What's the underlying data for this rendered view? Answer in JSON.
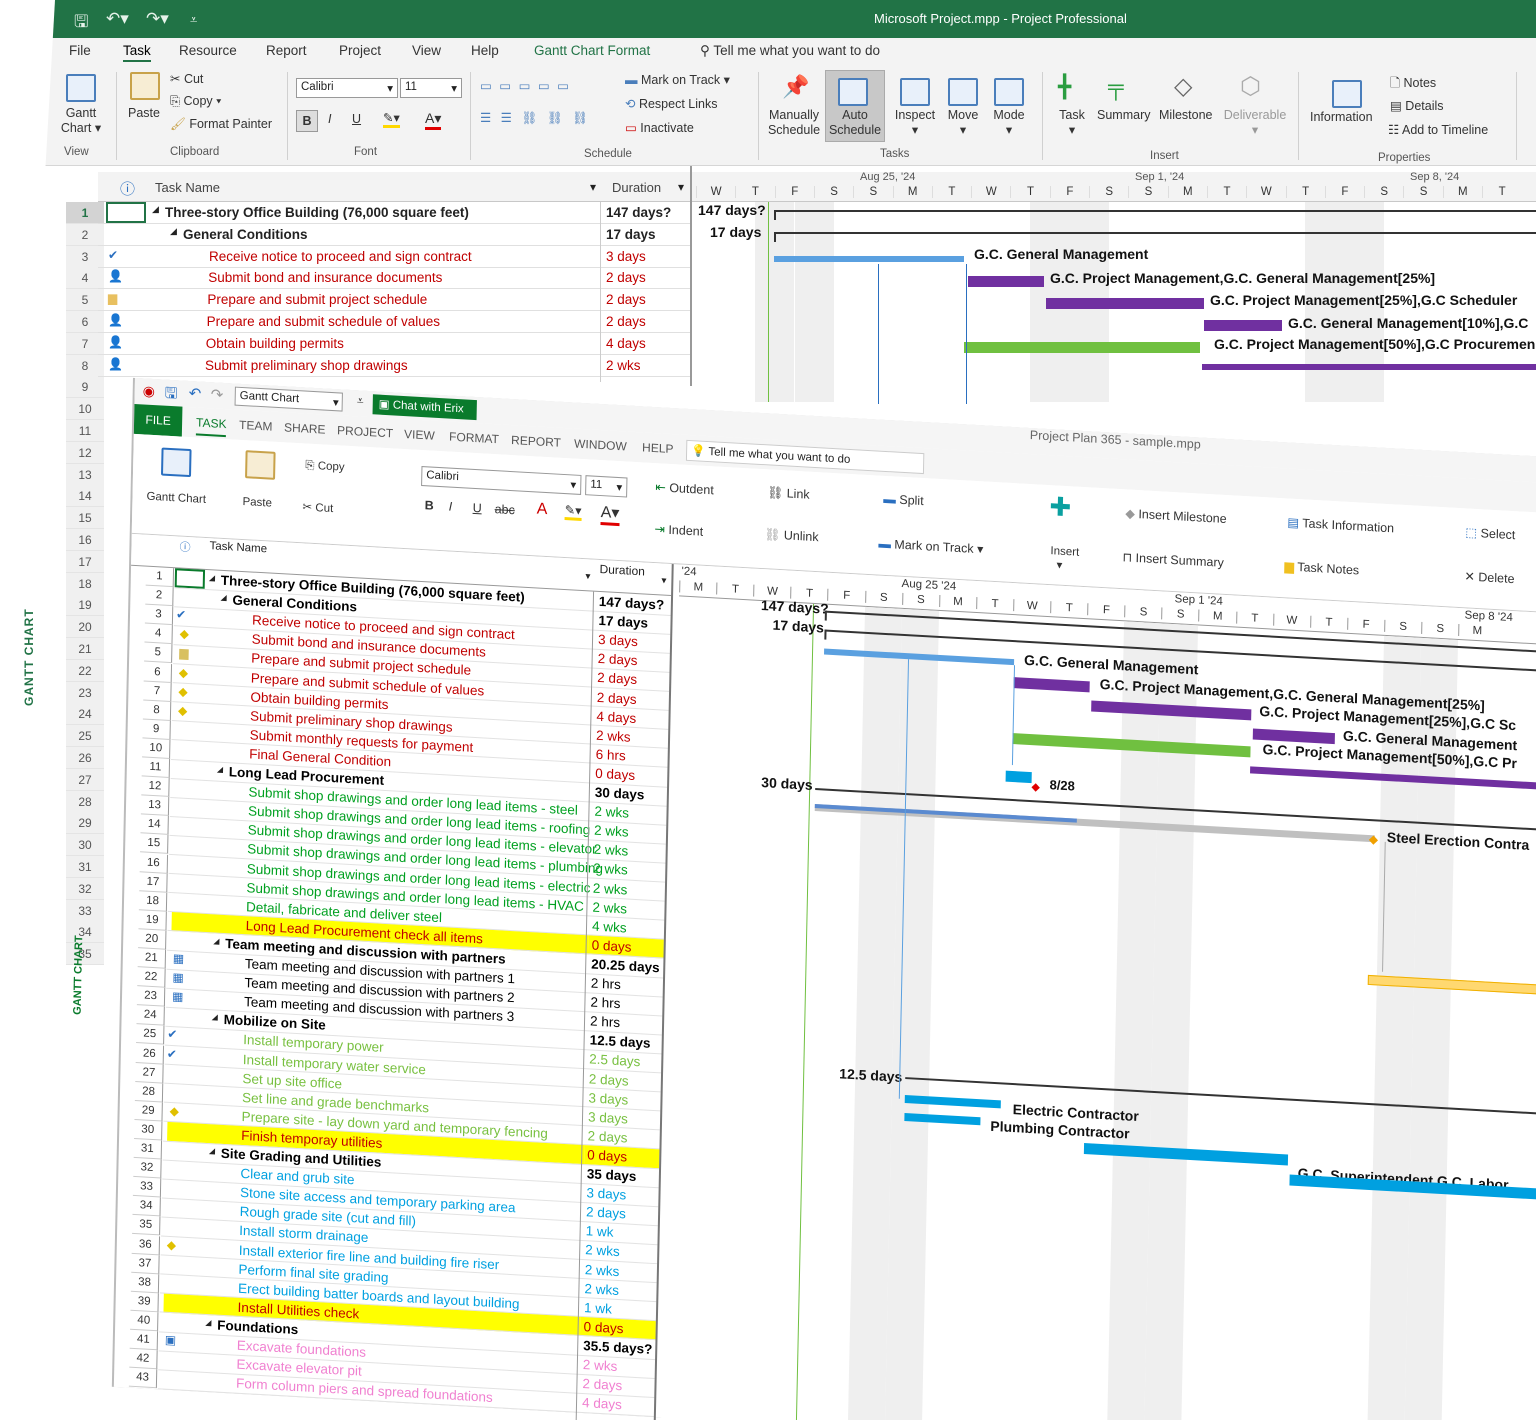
{
  "back": {
    "title": "Microsoft Project.mpp  -  Project Professional",
    "tabs": [
      "File",
      "Task",
      "Resource",
      "Report",
      "Project",
      "View",
      "Help",
      "Gantt Chart Format"
    ],
    "tellme": "Tell me what you want to do",
    "ribbon": {
      "gantt": "Gantt",
      "chart": "Chart",
      "paste": "Paste",
      "cut": "Cut",
      "copy": "Copy",
      "format_painter": "Format Painter",
      "font_name": "Calibri",
      "font_size": "11",
      "mark_on_track": "Mark on Track",
      "respect_links": "Respect Links",
      "inactivate": "Inactivate",
      "manually": "Manually",
      "schedule": "Schedule",
      "auto": "Auto",
      "inspect": "Inspect",
      "move": "Move",
      "mode": "Mode",
      "task": "Task",
      "summary": "Summary",
      "milestone": "Milestone",
      "deliverable": "Deliverable",
      "information": "Information",
      "notes": "Notes",
      "details": "Details",
      "add_to_timeline": "Add to Timeline",
      "groups": [
        "View",
        "Clipboard",
        "Font",
        "Schedule",
        "Tasks",
        "Insert",
        "Properties"
      ]
    },
    "sidebar_label": "GANTT CHART",
    "columns": {
      "task_name": "Task Name",
      "duration": "Duration"
    },
    "timeline": {
      "weeks": [
        "Aug 25, '24",
        "Sep 1, '24",
        "Sep 8, '24"
      ],
      "days": [
        "W",
        "T",
        "F",
        "S",
        "S",
        "M",
        "T",
        "W",
        "T",
        "F",
        "S",
        "S",
        "M",
        "T",
        "W",
        "T",
        "F",
        "S",
        "S",
        "M",
        "T"
      ]
    },
    "rows": [
      {
        "n": "1",
        "name": "Three-story Office Building (76,000 square feet)",
        "dur": "147 days?"
      },
      {
        "n": "2",
        "name": "General Conditions",
        "dur": "17 days"
      },
      {
        "n": "3",
        "name": "Receive notice to proceed and sign contract",
        "dur": "3 days"
      },
      {
        "n": "4",
        "name": "Submit bond and insurance documents",
        "dur": "2 days"
      },
      {
        "n": "5",
        "name": "Prepare and submit project schedule",
        "dur": "2 days"
      },
      {
        "n": "6",
        "name": "Prepare and submit schedule of values",
        "dur": "2 days"
      },
      {
        "n": "7",
        "name": "Obtain building permits",
        "dur": "4 days"
      },
      {
        "n": "8",
        "name": "Submit preliminary shop drawings",
        "dur": "2 wks"
      }
    ],
    "row_numbers": [
      "1",
      "2",
      "3",
      "4",
      "5",
      "6",
      "7",
      "8",
      "9",
      "10",
      "11",
      "12",
      "13",
      "14",
      "15",
      "16",
      "17",
      "18",
      "19",
      "20",
      "21",
      "22",
      "23",
      "24",
      "25",
      "26",
      "27",
      "28",
      "29",
      "30",
      "31",
      "32",
      "33",
      "34",
      "35"
    ],
    "chart_labels": {
      "total": "147 days?",
      "gc": "17 days",
      "l1": "G.C. General Management",
      "l2": "G.C. Project Management,G.C. General Management[25%]",
      "l3": "G.C. Project Management[25%],G.C Scheduler",
      "l4": "G.C. General Management[10%],G.C",
      "l5": "G.C. Project Management[50%],G.C Procuremen"
    }
  },
  "front": {
    "title": "Project Plan 365 - sample.mpp",
    "view_select": "Gantt Chart",
    "chat": "Chat with Erix",
    "menus": [
      "FILE",
      "TASK",
      "TEAM",
      "SHARE",
      "PROJECT",
      "VIEW",
      "FORMAT",
      "REPORT",
      "WINDOW",
      "HELP"
    ],
    "tellme": "Tell me what you want to do",
    "ribbon": {
      "gantt_chart": "Gantt Chart",
      "paste": "Paste",
      "copy": "Copy",
      "cut": "Cut",
      "font_name": "Calibri",
      "font_size": "11",
      "outdent": "Outdent",
      "indent": "Indent",
      "link": "Link",
      "unlink": "Unlink",
      "split": "Split",
      "mark_on_track": "Mark on Track",
      "insert": "Insert",
      "insert_milestone": "Insert Milestone",
      "insert_summary": "Insert Summary",
      "task_information": "Task Information",
      "task_notes": "Task Notes",
      "select": "Select",
      "delete": "Delete"
    },
    "sidebar_label": "GANTT CHART",
    "columns": {
      "task_name": "Task Name",
      "duration": "Duration"
    },
    "timeline": {
      "weeks": [
        "'24",
        "Aug 25 '24",
        "Sep 1 '24",
        "Sep 8 '24"
      ],
      "days": [
        "M",
        "T",
        "W",
        "T",
        "F",
        "S",
        "S",
        "M",
        "T",
        "W",
        "T",
        "F",
        "S",
        "S",
        "M",
        "T",
        "W",
        "T",
        "F",
        "S",
        "S",
        "M"
      ]
    },
    "rows": [
      {
        "n": "1",
        "name": "Three-story Office Building (76,000 square feet)",
        "dur": "147 days?",
        "lvl": 0,
        "style": "sum"
      },
      {
        "n": "2",
        "name": "General Conditions",
        "dur": "17 days",
        "lvl": 1,
        "style": "sum"
      },
      {
        "n": "3",
        "name": "Receive notice to proceed and sign contract",
        "dur": "3 days",
        "lvl": 2,
        "style": "red"
      },
      {
        "n": "4",
        "name": "Submit bond and insurance documents",
        "dur": "2 days",
        "lvl": 2,
        "style": "red"
      },
      {
        "n": "5",
        "name": "Prepare and submit project schedule",
        "dur": "2 days",
        "lvl": 2,
        "style": "red"
      },
      {
        "n": "6",
        "name": "Prepare and submit schedule of values",
        "dur": "2 days",
        "lvl": 2,
        "style": "red"
      },
      {
        "n": "7",
        "name": "Obtain building permits",
        "dur": "4 days",
        "lvl": 2,
        "style": "red"
      },
      {
        "n": "8",
        "name": "Submit preliminary shop drawings",
        "dur": "2 wks",
        "lvl": 2,
        "style": "red"
      },
      {
        "n": "9",
        "name": "Submit monthly requests for payment",
        "dur": "6 hrs",
        "lvl": 2,
        "style": "red"
      },
      {
        "n": "10",
        "name": "Final General Condition",
        "dur": "0 days",
        "lvl": 2,
        "style": "red"
      },
      {
        "n": "11",
        "name": "Long Lead Procurement",
        "dur": "30 days",
        "lvl": 1,
        "style": "sum"
      },
      {
        "n": "12",
        "name": "Submit shop drawings and order long lead items - steel",
        "dur": "2 wks",
        "lvl": 2,
        "style": "green"
      },
      {
        "n": "13",
        "name": "Submit shop drawings and order long lead items - roofing",
        "dur": "2 wks",
        "lvl": 2,
        "style": "green"
      },
      {
        "n": "14",
        "name": "Submit shop drawings and order long lead items - elevator",
        "dur": "2 wks",
        "lvl": 2,
        "style": "green"
      },
      {
        "n": "15",
        "name": "Submit shop drawings and order long lead items - plumbing",
        "dur": "2 wks",
        "lvl": 2,
        "style": "green"
      },
      {
        "n": "16",
        "name": "Submit shop drawings and order long lead items - electric",
        "dur": "2 wks",
        "lvl": 2,
        "style": "green"
      },
      {
        "n": "17",
        "name": "Submit shop drawings and order long lead items - HVAC",
        "dur": "2 wks",
        "lvl": 2,
        "style": "green"
      },
      {
        "n": "18",
        "name": "Detail, fabricate and deliver steel",
        "dur": "4 wks",
        "lvl": 2,
        "style": "green"
      },
      {
        "n": "19",
        "name": "Long Lead Procurement check all items",
        "dur": "0 days",
        "lvl": 2,
        "style": "red-hl"
      },
      {
        "n": "20",
        "name": "Team meeting and discussion with partners",
        "dur": "20.25 days",
        "lvl": 1,
        "style": "sum"
      },
      {
        "n": "21",
        "name": "Team meeting and discussion with partners 1",
        "dur": "2 hrs",
        "lvl": 2,
        "style": "black"
      },
      {
        "n": "22",
        "name": "Team meeting and discussion with partners 2",
        "dur": "2 hrs",
        "lvl": 2,
        "style": "black"
      },
      {
        "n": "23",
        "name": "Team meeting and discussion with partners 3",
        "dur": "2 hrs",
        "lvl": 2,
        "style": "black"
      },
      {
        "n": "24",
        "name": "Mobilize on Site",
        "dur": "12.5 days",
        "lvl": 1,
        "style": "sum"
      },
      {
        "n": "25",
        "name": "Install temporary power",
        "dur": "2.5 days",
        "lvl": 2,
        "style": "lgreen"
      },
      {
        "n": "26",
        "name": "Install temporary water service",
        "dur": "2 days",
        "lvl": 2,
        "style": "lgreen"
      },
      {
        "n": "27",
        "name": "Set up site office",
        "dur": "3 days",
        "lvl": 2,
        "style": "lgreen"
      },
      {
        "n": "28",
        "name": "Set line and grade benchmarks",
        "dur": "3 days",
        "lvl": 2,
        "style": "lgreen"
      },
      {
        "n": "29",
        "name": "Prepare site - lay down yard and temporary fencing",
        "dur": "2 days",
        "lvl": 2,
        "style": "lgreen"
      },
      {
        "n": "30",
        "name": "Finish temporay utilities",
        "dur": "0 days",
        "lvl": 2,
        "style": "red-hl"
      },
      {
        "n": "31",
        "name": "Site Grading and Utilities",
        "dur": "35 days",
        "lvl": 1,
        "style": "sum"
      },
      {
        "n": "32",
        "name": "Clear and grub site",
        "dur": "3 days",
        "lvl": 2,
        "style": "blue"
      },
      {
        "n": "33",
        "name": "Stone site access and temporary parking area",
        "dur": "2 days",
        "lvl": 2,
        "style": "blue"
      },
      {
        "n": "34",
        "name": "Rough grade site (cut and fill)",
        "dur": "1 wk",
        "lvl": 2,
        "style": "blue"
      },
      {
        "n": "35",
        "name": "Install storm drainage",
        "dur": "2 wks",
        "lvl": 2,
        "style": "blue"
      },
      {
        "n": "36",
        "name": "Install exterior fire line and building fire riser",
        "dur": "2 wks",
        "lvl": 2,
        "style": "blue"
      },
      {
        "n": "37",
        "name": "Perform final site grading",
        "dur": "2 wks",
        "lvl": 2,
        "style": "blue"
      },
      {
        "n": "38",
        "name": "Erect building batter boards and layout building",
        "dur": "1 wk",
        "lvl": 2,
        "style": "blue"
      },
      {
        "n": "39",
        "name": "Install Utilities check",
        "dur": "0 days",
        "lvl": 2,
        "style": "red-hl"
      },
      {
        "n": "40",
        "name": "Foundations",
        "dur": "35.5 days?",
        "lvl": 1,
        "style": "sum"
      },
      {
        "n": "41",
        "name": "Excavate foundations",
        "dur": "2 wks",
        "lvl": 2,
        "style": "pink"
      },
      {
        "n": "42",
        "name": "Excavate elevator pit",
        "dur": "2 days",
        "lvl": 2,
        "style": "pink"
      },
      {
        "n": "43",
        "name": "Form column piers and spread foundations",
        "dur": "4 days",
        "lvl": 2,
        "style": "pink"
      }
    ],
    "chart_labels": {
      "total": "147 days?",
      "gc": "17 days",
      "l1": "G.C. General Management",
      "l2": "G.C. Project Management,G.C. General Management[25%]",
      "l3": "G.C. Project Management[25%],G.C Sc",
      "l4": "G.C. General Management",
      "l5": "G.C. Project Management[50%],G.C Pr",
      "milestone_date": "8/28",
      "lead": "30 days",
      "steel": "Steel Erection Contra",
      "mobilize": "12.5 days",
      "electric": "Electric Contractor",
      "plumbing": "Plumbing Contractor",
      "super": "G.C. Superintendent,G.C. Labor"
    }
  }
}
